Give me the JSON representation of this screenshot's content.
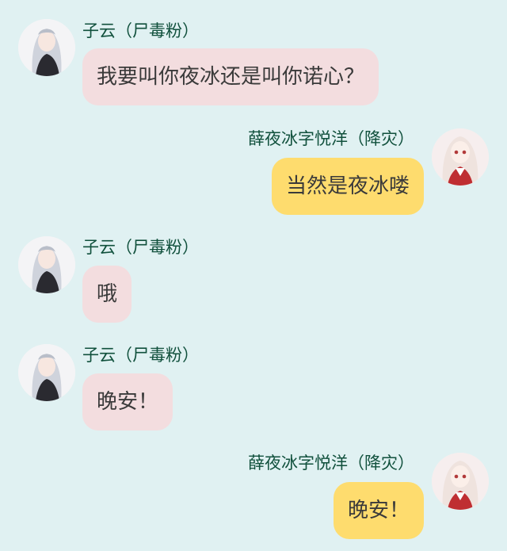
{
  "messages": [
    {
      "side": "left",
      "sender": "子云（尸毒粉）",
      "text": "我要叫你夜冰还是叫你诺心？"
    },
    {
      "side": "right",
      "sender": "薛夜冰字悦洋（降灾）",
      "text": "当然是夜冰喽"
    },
    {
      "side": "left",
      "sender": "子云（尸毒粉）",
      "text": "哦"
    },
    {
      "side": "left",
      "sender": "子云（尸毒粉）",
      "text": "晚安！"
    },
    {
      "side": "right",
      "sender": "薛夜冰字悦洋（降灾）",
      "text": "晚安！"
    }
  ],
  "colors": {
    "background": "#e0f1f2",
    "left_bubble": "#f3dddf",
    "right_bubble": "#fedc6e",
    "sender_name": "#10503c"
  },
  "icons": {
    "left_avatar": "avatar-dark-jacket-white-hair",
    "right_avatar": "avatar-white-hair-red-kimono"
  }
}
